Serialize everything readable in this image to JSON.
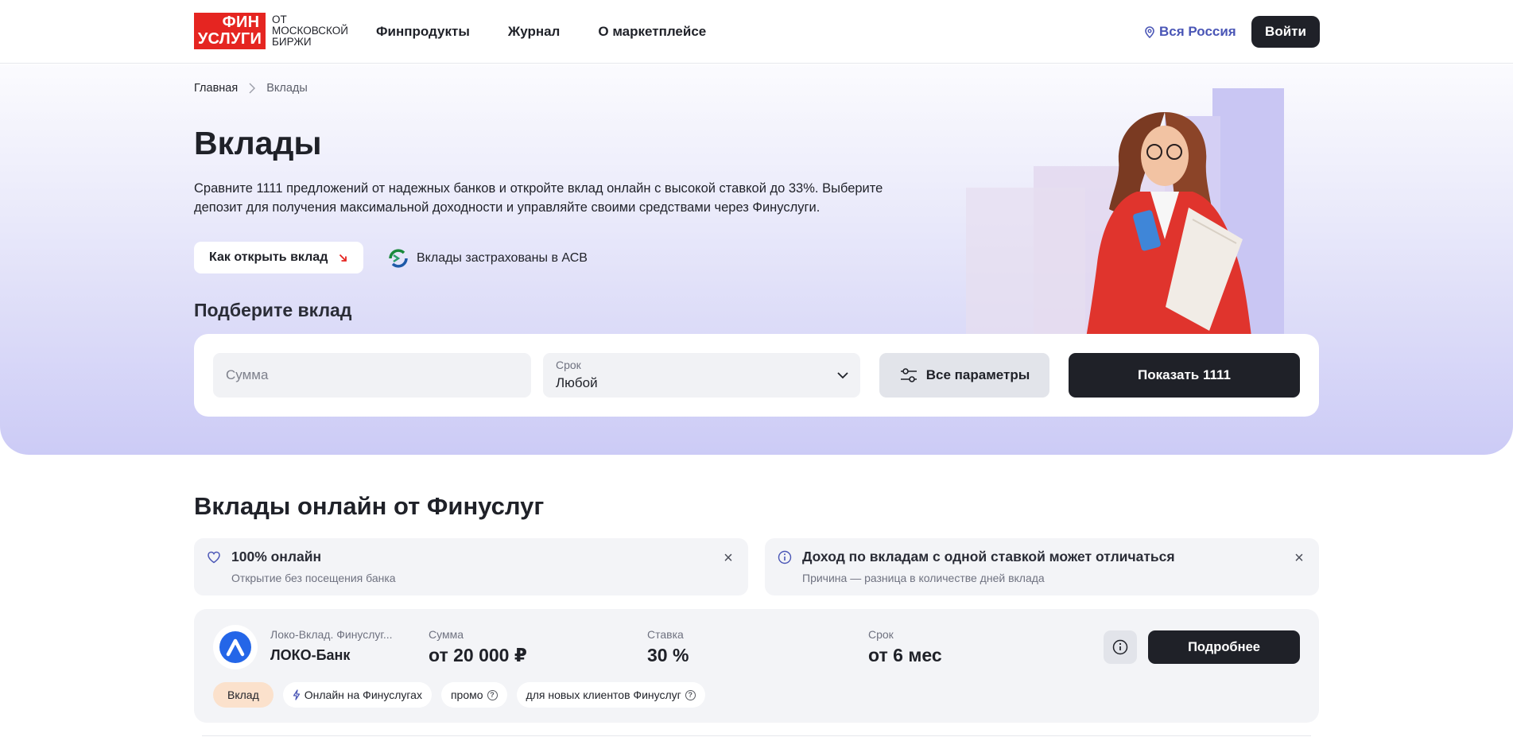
{
  "header": {
    "logo_line1": "ФИН",
    "logo_line2": "УСЛУГИ",
    "logo_sub": "от Московской биржи",
    "nav": [
      "Финпродукты",
      "Журнал",
      "О маркетплейсе"
    ],
    "region": "Вся Россия",
    "login": "Войти"
  },
  "breadcrumbs": {
    "home": "Главная",
    "current": "Вклады"
  },
  "hero": {
    "title": "Вклады",
    "description": "Сравните 1111 предложений от надежных банков и откройте вклад онлайн с высокой ставкой до 33%. Выберите депозит для получения максимальной доходности и управляйте своими средствами через Финуслуги.",
    "how_button": "Как открыть вклад",
    "asv_text": "Вклады застрахованы в АСВ",
    "pick_title": "Подберите вклад"
  },
  "filters": {
    "sum_placeholder": "Сумма",
    "term_label": "Срок",
    "term_value": "Любой",
    "params_button": "Все параметры",
    "show_button": "Показать 1111"
  },
  "online": {
    "title": "Вклады онлайн от Финуслуг",
    "cards": [
      {
        "title": "100% онлайн",
        "sub": "Открытие без посещения банка"
      },
      {
        "title": "Доход по вкладам с одной ставкой может отличаться",
        "sub": "Причина — разница в количестве дней вклада"
      }
    ]
  },
  "offer": {
    "name": "Локо-Вклад. Финуслуг...",
    "bank": "ЛОКО-Банк",
    "sum_label": "Сумма",
    "sum_value": "от 20 000 ₽",
    "rate_label": "Ставка",
    "rate_value": "30 %",
    "term_label": "Срок",
    "term_value": "от 6 мес",
    "more_button": "Подробнее",
    "tags": [
      "Вклад",
      "Онлайн на Финуслугах",
      "промо",
      "для новых клиентов Финуслуг"
    ]
  },
  "colors": {
    "brand_red": "#e52521",
    "dark": "#1f2128",
    "accent_blue": "#4a56b6",
    "hero_purple": "#cccbf6"
  }
}
